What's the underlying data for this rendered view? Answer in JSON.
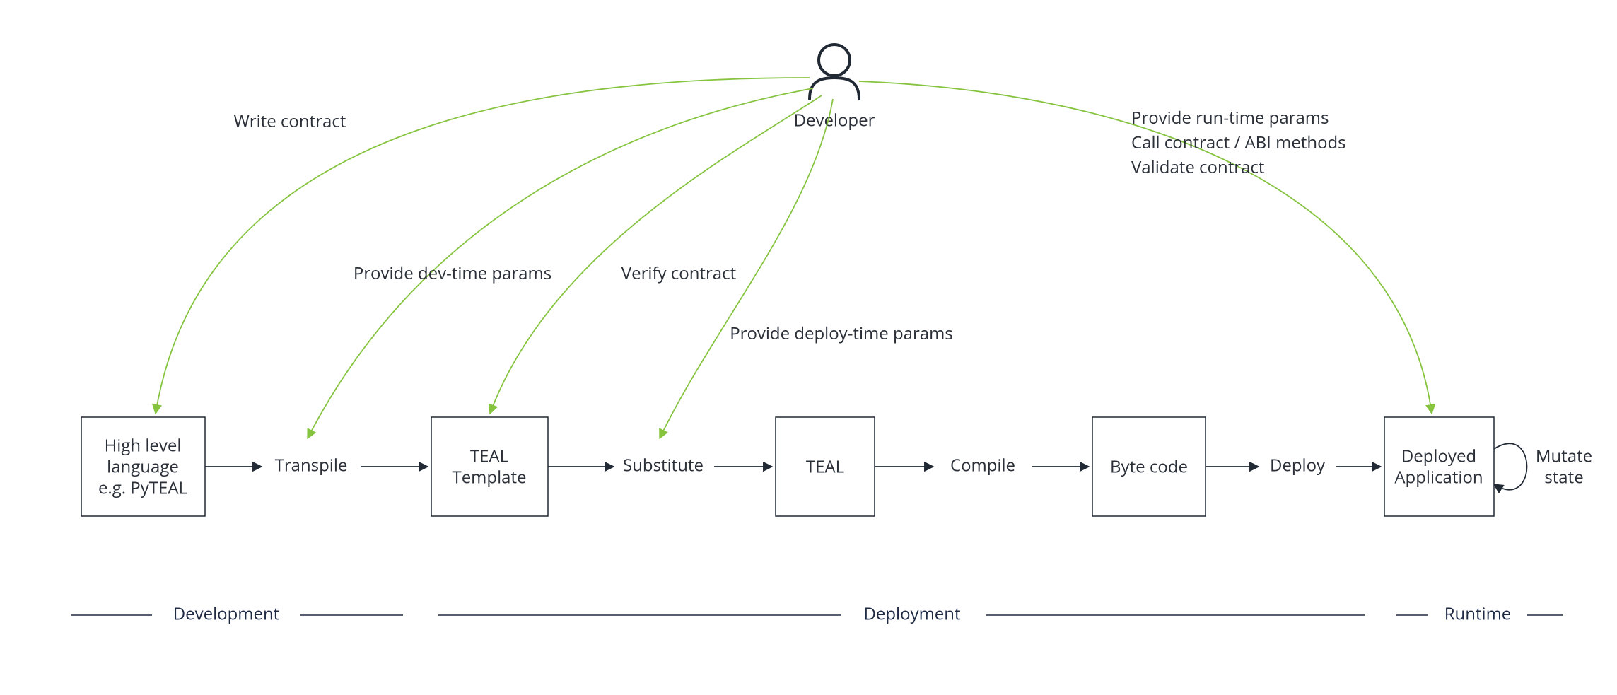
{
  "actor": {
    "label": "Developer"
  },
  "nodes": {
    "hll": {
      "lines": [
        "High level",
        "language",
        "e.g. PyTEAL"
      ]
    },
    "template": {
      "lines": [
        "TEAL",
        "Template"
      ]
    },
    "teal": {
      "lines": [
        "TEAL"
      ]
    },
    "bytecode": {
      "lines": [
        "Byte code"
      ]
    },
    "deployed": {
      "lines": [
        "Deployed",
        "Application"
      ]
    }
  },
  "flow_edges": {
    "transpile": "Transpile",
    "substitute": "Substitute",
    "compile": "Compile",
    "deploy": "Deploy",
    "mutate": {
      "lines": [
        "Mutate",
        "state"
      ]
    }
  },
  "dev_arrows": {
    "write": "Write contract",
    "dev_params": "Provide dev-time params",
    "verify": "Verify contract",
    "deploy_params": "Provide deploy-time params",
    "runtime": {
      "lines": [
        "Provide run-time params",
        "Call contract / ABI methods",
        "Validate contract"
      ]
    }
  },
  "phases": {
    "development": "Development",
    "deployment": "Deployment",
    "runtime": "Runtime"
  }
}
